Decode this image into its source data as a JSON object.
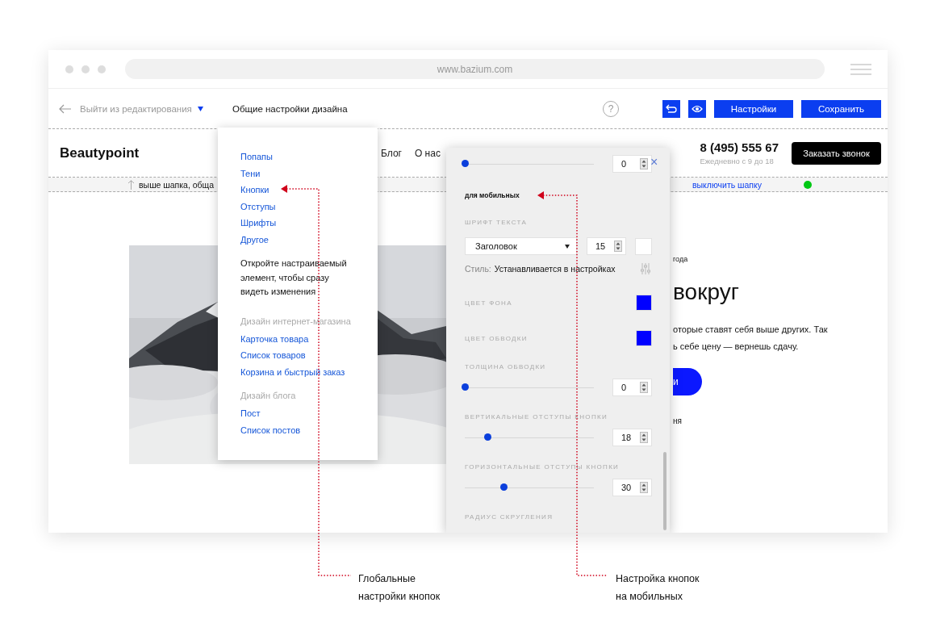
{
  "browser": {
    "address": "www.bazium.com"
  },
  "editor_toolbar": {
    "exit_label": "Выйти из редактирования",
    "menu_title": "Общие настройки дизайна",
    "help": "?",
    "buttons": [
      "Настройки",
      "Сохранить"
    ]
  },
  "site_header": {
    "logo": "Beautypoint",
    "nav": [
      "Блог",
      "О нас"
    ],
    "phone": "8 (495) 555 67",
    "hours": "Ежедневно с 9 до 18",
    "cta": "Заказать звонок"
  },
  "above_header_bar": {
    "text": "выше шапка, обща",
    "toggle_link": "выключить шапку"
  },
  "hero": {
    "caption": "года",
    "heading": "вокруг",
    "paragraph_lines": [
      "оторые ставят себя выше других. Так",
      "ь себе цену — вернешь сдачу."
    ],
    "button": "и",
    "note": "ня"
  },
  "design_menu": {
    "items": [
      {
        "kind": "link",
        "text": "Попапы"
      },
      {
        "kind": "link",
        "text": "Тени"
      },
      {
        "kind": "link",
        "text": "Кнопки"
      },
      {
        "kind": "link",
        "text": "Отступы"
      },
      {
        "kind": "link",
        "text": "Шрифты"
      },
      {
        "kind": "link",
        "text": "Другое"
      },
      {
        "kind": "note",
        "text": "Откройте настраиваемый элемент, чтобы сразу видеть изменения"
      },
      {
        "kind": "heading",
        "text": "Дизайн интернет-магазина"
      },
      {
        "kind": "link",
        "text": "Карточка товара"
      },
      {
        "kind": "link",
        "text": "Список товаров"
      },
      {
        "kind": "link",
        "text": "Корзина и быстрый заказ"
      },
      {
        "kind": "heading",
        "text": "Дизайн блога"
      },
      {
        "kind": "link",
        "text": "Пост"
      },
      {
        "kind": "link",
        "text": "Список постов"
      }
    ]
  },
  "panel": {
    "close": "×",
    "rows": [
      {
        "kind": "slider",
        "level": 0,
        "value": "0"
      },
      {
        "kind": "title",
        "text": "для мобильных"
      },
      {
        "kind": "label",
        "text": "ШРИФТ ТЕКСТА"
      },
      {
        "kind": "font",
        "font": "Заголовок",
        "size": "15",
        "color": "#ffffff"
      },
      {
        "kind": "style",
        "label": "Стиль:",
        "value": "Устанавливается в настройках"
      },
      {
        "kind": "color",
        "label": "ЦВЕТ ФОНА",
        "color": "#0000ff"
      },
      {
        "kind": "color",
        "label": "ЦВЕТ ОБВОДКИ",
        "color": "#0000ff"
      },
      {
        "kind": "label",
        "text": "ТОЛЩИНА ОБВОДКИ"
      },
      {
        "kind": "slider",
        "level": 0,
        "value": "0"
      },
      {
        "kind": "label",
        "text": "ВЕРТИКАЛЬНЫЕ ОТСТУПЫ КНОПКИ"
      },
      {
        "kind": "slider",
        "level": 0.18,
        "value": "18"
      },
      {
        "kind": "label",
        "text": "ГОРИЗОНТАЛЬНЫЕ ОТСТУПЫ КНОПКИ"
      },
      {
        "kind": "slider",
        "level": 0.3,
        "value": "30"
      },
      {
        "kind": "label",
        "text": "РАДИУС СКРУГЛЕНИЯ"
      }
    ]
  },
  "annotations": [
    {
      "text": "Глобальные\nнастройки кнопок"
    },
    {
      "text": "Настройка кнопок\nна мобильных"
    }
  ]
}
